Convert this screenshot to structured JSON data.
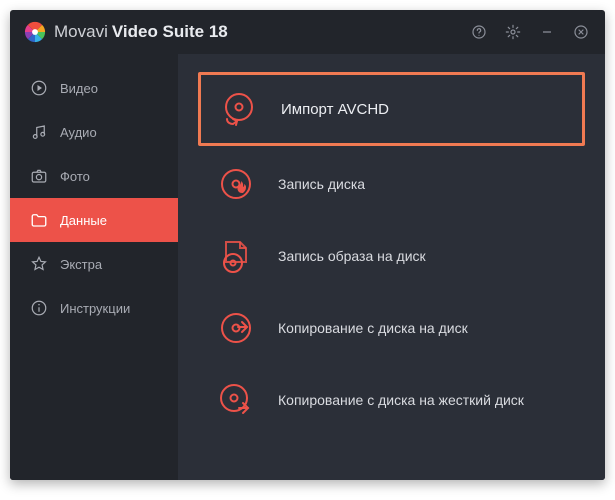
{
  "app": {
    "title_light": "Movavi",
    "title_bold": "Video Suite 18"
  },
  "sidebar": {
    "items": [
      {
        "label": "Видео"
      },
      {
        "label": "Аудио"
      },
      {
        "label": "Фото"
      },
      {
        "label": "Данные"
      },
      {
        "label": "Экстра"
      },
      {
        "label": "Инструкции"
      }
    ]
  },
  "content": {
    "items": [
      {
        "label": "Импорт AVCHD"
      },
      {
        "label": "Запись диска"
      },
      {
        "label": "Запись образа на диск"
      },
      {
        "label": "Копирование с диска на диск"
      },
      {
        "label": "Копирование с диска на жесткий диск"
      }
    ]
  },
  "colors": {
    "accent": "#ed5249",
    "highlight_border": "#f07a52",
    "panel_dark": "#22252b",
    "panel_light": "#2b2f38"
  }
}
